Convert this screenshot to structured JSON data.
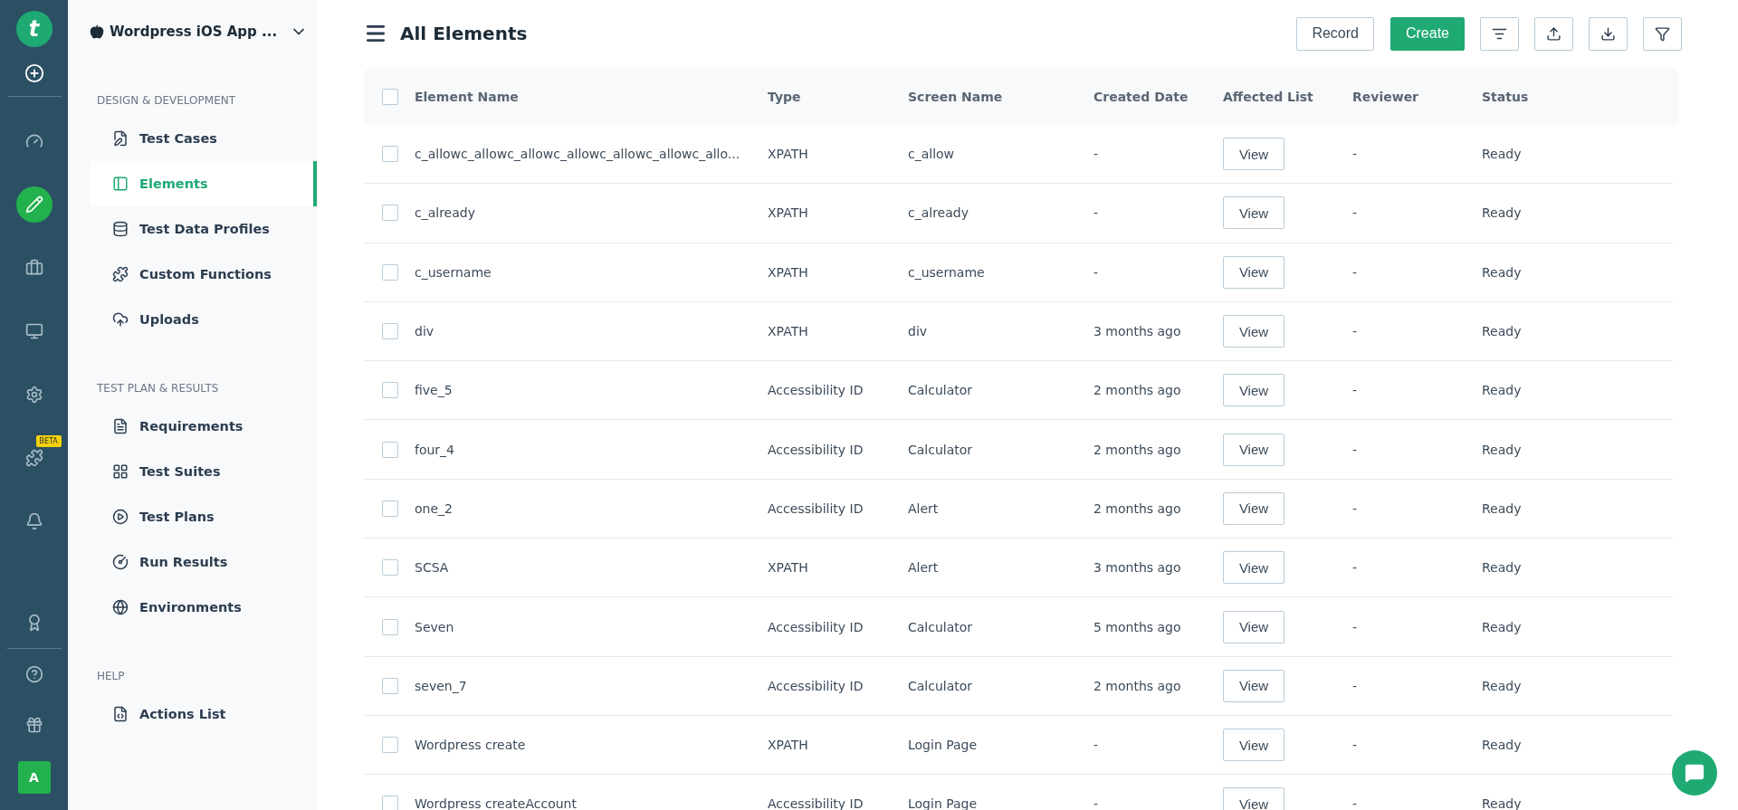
{
  "rail": {
    "logo": "t",
    "items": [
      {
        "kind": "dashboard",
        "selected": false
      },
      {
        "kind": "edit",
        "selected": true
      },
      {
        "kind": "briefcase",
        "selected": false
      },
      {
        "kind": "monitor",
        "selected": false
      },
      {
        "kind": "settings",
        "selected": false
      },
      {
        "kind": "addons",
        "selected": false,
        "badge": "BETA"
      },
      {
        "kind": "bell",
        "selected": false
      }
    ],
    "bottom": [
      {
        "kind": "award"
      },
      {
        "kind": "help"
      },
      {
        "kind": "gift"
      }
    ],
    "avatar": "A"
  },
  "sidebar": {
    "project": "Wordpress iOS App ...",
    "sections": [
      {
        "heading": "DESIGN & DEVELOPMENT",
        "items": [
          {
            "label": "Test Cases",
            "selected": false
          },
          {
            "label": "Elements",
            "selected": true
          },
          {
            "label": "Test Data Profiles",
            "selected": false
          },
          {
            "label": "Custom Functions",
            "selected": false
          },
          {
            "label": "Uploads",
            "selected": false
          }
        ]
      },
      {
        "heading": "TEST PLAN & RESULTS",
        "items": [
          {
            "label": "Requirements",
            "selected": false
          },
          {
            "label": "Test Suites",
            "selected": false
          },
          {
            "label": "Test Plans",
            "selected": false
          },
          {
            "label": "Run Results",
            "selected": false
          },
          {
            "label": "Environments",
            "selected": false
          }
        ]
      },
      {
        "heading": "HELP",
        "items": [
          {
            "label": "Actions List",
            "selected": false
          }
        ]
      }
    ]
  },
  "header": {
    "title": "All Elements",
    "buttons": [
      {
        "label": "Record",
        "kind": "outline"
      },
      {
        "label": "Create",
        "kind": "primary"
      }
    ],
    "tools": [
      {
        "kind": "sort"
      },
      {
        "kind": "upload"
      },
      {
        "kind": "download"
      },
      {
        "kind": "filter"
      }
    ]
  },
  "table": {
    "columns": [
      "Element Name",
      "Type",
      "Screen Name",
      "Created Date",
      "Affected List",
      "Reviewer",
      "Status"
    ],
    "all_checked": false,
    "rows": [
      {
        "checked": false,
        "name": "c_allowc_allowc_allowc_allowc_allowc_allowc_allo...",
        "type": "XPATH",
        "screen": "c_allow",
        "created": "-",
        "affected": "View",
        "reviewer": "-",
        "status": "Ready"
      },
      {
        "checked": false,
        "name": "c_already",
        "type": "XPATH",
        "screen": "c_already",
        "created": "-",
        "affected": "View",
        "reviewer": "-",
        "status": "Ready"
      },
      {
        "checked": false,
        "name": "c_username",
        "type": "XPATH",
        "screen": "c_username",
        "created": "-",
        "affected": "View",
        "reviewer": "-",
        "status": "Ready"
      },
      {
        "checked": false,
        "name": "div",
        "type": "XPATH",
        "screen": "div",
        "created": "3 months ago",
        "affected": "View",
        "reviewer": "-",
        "status": "Ready"
      },
      {
        "checked": false,
        "name": "five_5",
        "type": "Accessibility ID",
        "screen": "Calculator",
        "created": "2 months ago",
        "affected": "View",
        "reviewer": "-",
        "status": "Ready"
      },
      {
        "checked": false,
        "name": "four_4",
        "type": "Accessibility ID",
        "screen": "Calculator",
        "created": "2 months ago",
        "affected": "View",
        "reviewer": "-",
        "status": "Ready"
      },
      {
        "checked": false,
        "name": "one_2",
        "type": "Accessibility ID",
        "screen": "Alert",
        "created": "2 months ago",
        "affected": "View",
        "reviewer": "-",
        "status": "Ready"
      },
      {
        "checked": false,
        "name": "SCSA",
        "type": "XPATH",
        "screen": "Alert",
        "created": "3 months ago",
        "affected": "View",
        "reviewer": "-",
        "status": "Ready"
      },
      {
        "checked": false,
        "name": "Seven",
        "type": "Accessibility ID",
        "screen": "Calculator",
        "created": "5 months ago",
        "affected": "View",
        "reviewer": "-",
        "status": "Ready"
      },
      {
        "checked": false,
        "name": "seven_7",
        "type": "Accessibility ID",
        "screen": "Calculator",
        "created": "2 months ago",
        "affected": "View",
        "reviewer": "-",
        "status": "Ready"
      },
      {
        "checked": false,
        "name": "Wordpress create",
        "type": "XPATH",
        "screen": "Login Page",
        "created": "-",
        "affected": "View",
        "reviewer": "-",
        "status": "Ready"
      },
      {
        "checked": false,
        "name": "Wordpress createAccount",
        "type": "Accessibility ID",
        "screen": "Login Page",
        "created": "-",
        "affected": "View",
        "reviewer": "-",
        "status": "Ready"
      }
    ]
  }
}
